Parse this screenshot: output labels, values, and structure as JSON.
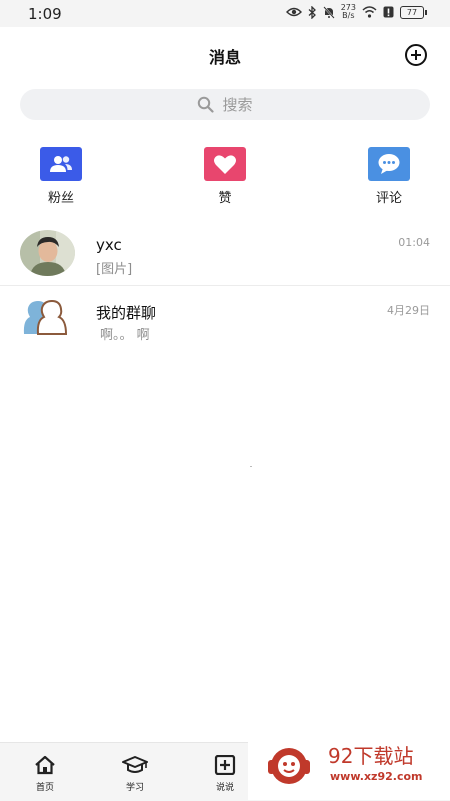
{
  "status_bar": {
    "time": "1:09",
    "speed_value": "273",
    "speed_unit": "B/s",
    "battery": "77"
  },
  "header": {
    "title": "消息"
  },
  "search": {
    "placeholder": "搜索"
  },
  "quick_entries": [
    {
      "label": "粉丝",
      "icon": "people-icon",
      "color": "#3b5be8"
    },
    {
      "label": "赞",
      "icon": "heart-icon",
      "color": "#e8466e"
    },
    {
      "label": "评论",
      "icon": "comment-icon",
      "color": "#4a90e2"
    }
  ],
  "conversations": [
    {
      "name": "yxc",
      "preview": "[图片]",
      "time": "01:04",
      "avatar": "user-photo"
    },
    {
      "name": "我的群聊",
      "preview": "啊。。  啊",
      "time": "4月29日",
      "avatar": "group-icon"
    }
  ],
  "bottom_nav": [
    {
      "label": "首页",
      "icon": "home-icon"
    },
    {
      "label": "学习",
      "icon": "graduation-cap-icon"
    },
    {
      "label": "说说",
      "icon": "plus-square-icon"
    }
  ],
  "watermark": {
    "title": "92下载站",
    "url": "www.xz92.com"
  }
}
